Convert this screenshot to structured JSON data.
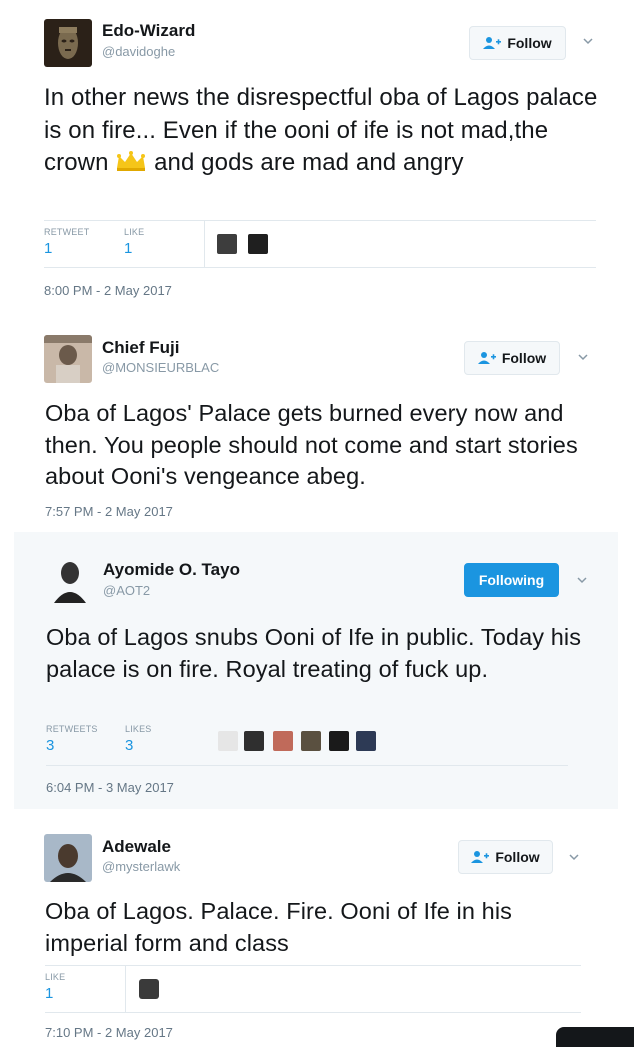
{
  "tweets": [
    {
      "name": "Edo-Wizard",
      "handle": "@davidoghe",
      "follow_label": "Follow",
      "text_before_emoji": "In other news the disrespectful oba of Lagos palace is on fire... Even if the ooni of ife is not mad,the crown ",
      "emoji": "crown-emoji",
      "text_after_emoji": " and gods are mad and angry",
      "stats": [
        {
          "label": "RETWEET",
          "value": "1"
        },
        {
          "label": "LIKE",
          "value": "1"
        }
      ],
      "timestamp": "8:00 PM - 2 May 2017"
    },
    {
      "name": "Chief Fuji",
      "handle": "@MONSIEURBLAC",
      "follow_label": "Follow",
      "text": "Oba of Lagos' Palace gets burned every now and then. You people should not come and start stories about Ooni's vengeance abeg.",
      "timestamp": "7:57 PM - 2 May 2017"
    },
    {
      "name": "Ayomide O. Tayo",
      "handle": "@AOT2",
      "follow_label": "Following",
      "text": "Oba of Lagos snubs Ooni of Ife in public. Today his palace is on fire. Royal treating of fuck up.",
      "stats": [
        {
          "label": "RETWEETS",
          "value": "3"
        },
        {
          "label": "LIKES",
          "value": "3"
        }
      ],
      "timestamp": "6:04 PM - 3 May 2017"
    },
    {
      "name": "Adewale",
      "handle": "@mysterlawk",
      "follow_label": "Follow",
      "text": "Oba of Lagos. Palace. Fire. Ooni of Ife in his imperial form and class",
      "stats": [
        {
          "label": "LIKE",
          "value": "1"
        }
      ],
      "timestamp": "7:10 PM - 2 May 2017"
    }
  ],
  "colors": {
    "link_blue": "#1b95e0",
    "muted_gray": "#8899a6",
    "border": "#e1e8ed",
    "highlight_bg": "#f5f8fa"
  }
}
